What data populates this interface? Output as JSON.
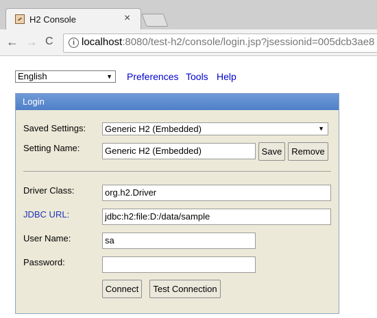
{
  "browser": {
    "tab_title": "H2 Console",
    "close_glyph": "×",
    "back_glyph": "←",
    "forward_glyph": "→",
    "reload_glyph": "C",
    "info_glyph": "i",
    "url_host": "localhost",
    "url_rest": ":8080/test-h2/console/login.jsp?jsessionid=005dcb3ae8"
  },
  "top": {
    "language": "English",
    "links": [
      "Preferences",
      "Tools",
      "Help"
    ]
  },
  "login": {
    "header": "Login",
    "saved_settings_label": "Saved Settings:",
    "saved_settings_value": "Generic H2 (Embedded)",
    "setting_name_label": "Setting Name:",
    "setting_name_value": "Generic H2 (Embedded)",
    "save_button": "Save",
    "remove_button": "Remove",
    "driver_class_label": "Driver Class:",
    "driver_class_value": "org.h2.Driver",
    "jdbc_url_label": "JDBC URL:",
    "jdbc_url_value": "jdbc:h2:file:D:/data/sample",
    "user_name_label": "User Name:",
    "user_name_value": "sa",
    "password_label": "Password:",
    "password_value": "",
    "connect_button": "Connect",
    "test_connection_button": "Test Connection"
  },
  "colors": {
    "panel_bg": "#ece9d8",
    "header_blue": "#5b8ad0",
    "link_blue": "#0000cc"
  },
  "dropdown_arrow": "▼"
}
